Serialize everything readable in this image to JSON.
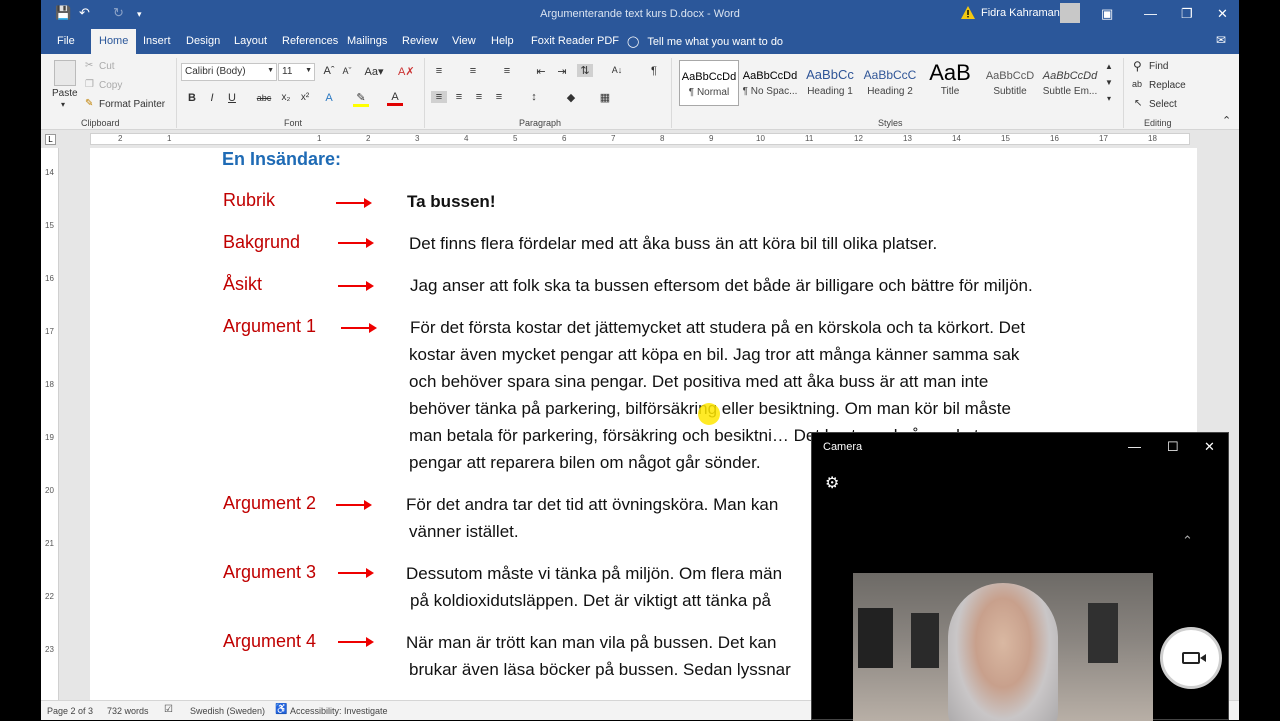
{
  "titlebar": {
    "title": "Argumenterande text kurs D.docx  -  Word",
    "user_name": "Fidra Kahraman"
  },
  "tabs": [
    "File",
    "Home",
    "Insert",
    "Design",
    "Layout",
    "References",
    "Mailings",
    "Review",
    "View",
    "Help",
    "Foxit Reader PDF"
  ],
  "tell_me": "Tell me what you want to do",
  "ribbon": {
    "clipboard": {
      "label": "Clipboard",
      "paste": "Paste",
      "cut": "Cut",
      "copy": "Copy",
      "format_painter": "Format Painter"
    },
    "font": {
      "label": "Font",
      "font_name": "Calibri (Body)",
      "font_size": "11"
    },
    "paragraph": {
      "label": "Paragraph"
    },
    "styles": {
      "label": "Styles",
      "items": [
        {
          "preview": "AaBbCcDd",
          "name": "¶ Normal"
        },
        {
          "preview": "AaBbCcDd",
          "name": "¶ No Spac..."
        },
        {
          "preview": "AaBbCc",
          "name": "Heading 1"
        },
        {
          "preview": "AaBbCcC",
          "name": "Heading 2"
        },
        {
          "preview": "AaB",
          "name": "Title"
        },
        {
          "preview": "AaBbCcD",
          "name": "Subtitle"
        },
        {
          "preview": "AaBbCcDd",
          "name": "Subtle Em..."
        }
      ]
    },
    "editing": {
      "label": "Editing",
      "find": "Find",
      "replace": "Replace",
      "select": "Select"
    }
  },
  "ruler": {
    "h_ticks": [
      "2",
      "1",
      "1",
      "2",
      "3",
      "4",
      "5",
      "6",
      "7",
      "8",
      "9",
      "10",
      "11",
      "12",
      "13",
      "14",
      "15",
      "16",
      "17",
      "18"
    ],
    "v_ticks": [
      "14",
      "15",
      "16",
      "17",
      "18",
      "19",
      "20",
      "21",
      "22",
      "23"
    ]
  },
  "document": {
    "heading": "En Insändare:",
    "rows": [
      {
        "label": "Rubrik",
        "text": "Ta bussen!",
        "bold": true
      },
      {
        "label": "Bakgrund",
        "text": "Det finns flera fördelar med att åka buss än att köra bil till olika platser."
      },
      {
        "label": "Åsikt",
        "text": "Jag anser att folk ska ta bussen eftersom det både är billigare och bättre för miljön."
      },
      {
        "label": "Argument 1",
        "lines": [
          "För det första kostar det jättemycket att studera på en körskola och ta körkort. Det",
          "kostar även mycket pengar att köpa en bil. Jag tror att många känner samma sak",
          "och behöver spara sina pengar. Det positiva med att åka buss är att man inte",
          "behöver tänka på parkering, bilförsäkring eller besiktning. Om man kör bil måste",
          "man betala för parkering, försäkring och besiktni… Det kostar också mycket",
          "pengar att reparera bilen om något går sönder."
        ]
      },
      {
        "label": "Argument 2",
        "lines": [
          "För det andra tar det tid att övningsköra. Man kan",
          "vänner istället."
        ]
      },
      {
        "label": "Argument 3",
        "lines": [
          "Dessutom måste vi tänka på miljön. Om flera män",
          "på koldioxidutsläppen. Det är viktigt att tänka på"
        ]
      },
      {
        "label": "Argument 4",
        "lines": [
          "När man är trött kan man vila på bussen. Det kan",
          "brukar även läsa böcker på bussen. Sedan lyssnar"
        ]
      }
    ]
  },
  "statusbar": {
    "page": "Page 2 of 3",
    "words": "732 words",
    "language": "Swedish (Sweden)",
    "accessibility": "Accessibility: Investigate"
  },
  "camera": {
    "title": "Camera"
  },
  "colors": {
    "word_blue": "#2b579a",
    "label_red": "#c00000",
    "heading_blue": "#1f6bb5"
  }
}
